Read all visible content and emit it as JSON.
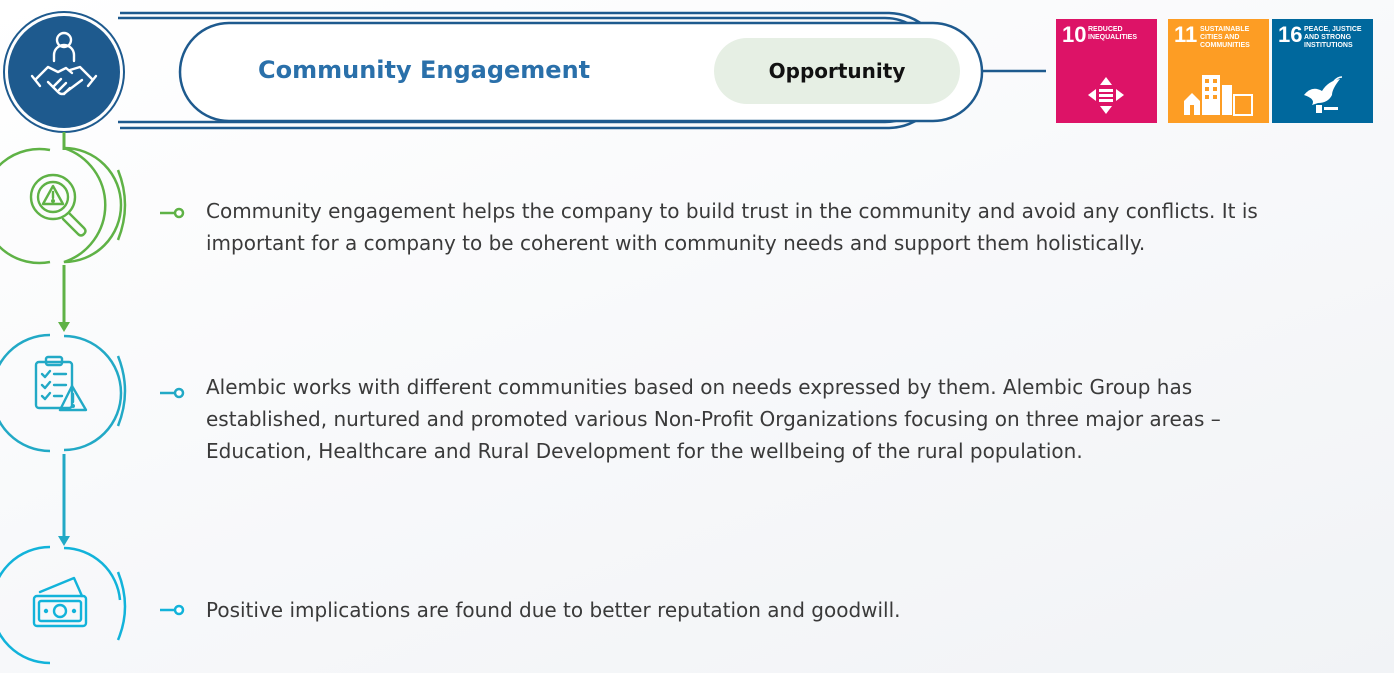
{
  "header": {
    "title": "Community Engagement",
    "badge": "Opportunity"
  },
  "sdgs": [
    {
      "number": "10",
      "label": "REDUCED INEQUALITIES",
      "color": "#dd1367",
      "icon": "reduced-inequalities-icon"
    },
    {
      "number": "11",
      "label": "SUSTAINABLE CITIES AND COMMUNITIES",
      "color": "#fd9d24",
      "icon": "sustainable-cities-icon"
    },
    {
      "number": "16",
      "label": "PEACE, JUSTICE AND STRONG INSTITUTIONS",
      "color": "#00689d",
      "icon": "peace-dove-icon"
    }
  ],
  "sections": [
    {
      "icon": "magnifier-warning-icon",
      "text": "Community engagement helps the company to build trust in the community and avoid any conflicts. It is important for a company to be coherent with community needs and support them holistically."
    },
    {
      "icon": "clipboard-warning-icon",
      "text": "Alembic works with different communities based on needs expressed by them. Alembic Group has established, nurtured and promoted various Non-Profit Organizations focusing on three major areas – Education, Healthcare and Rural Development for the wellbeing of the rural population."
    },
    {
      "icon": "money-icon",
      "text": "Positive implications are found due to better reputation and goodwill."
    }
  ],
  "colors": {
    "navy": "#1e5a8e",
    "title_blue": "#2a70aa",
    "green": "#5fb246",
    "teal": "#22a9c6",
    "cyan": "#12b3da",
    "pill_bg": "#e6efe4"
  }
}
